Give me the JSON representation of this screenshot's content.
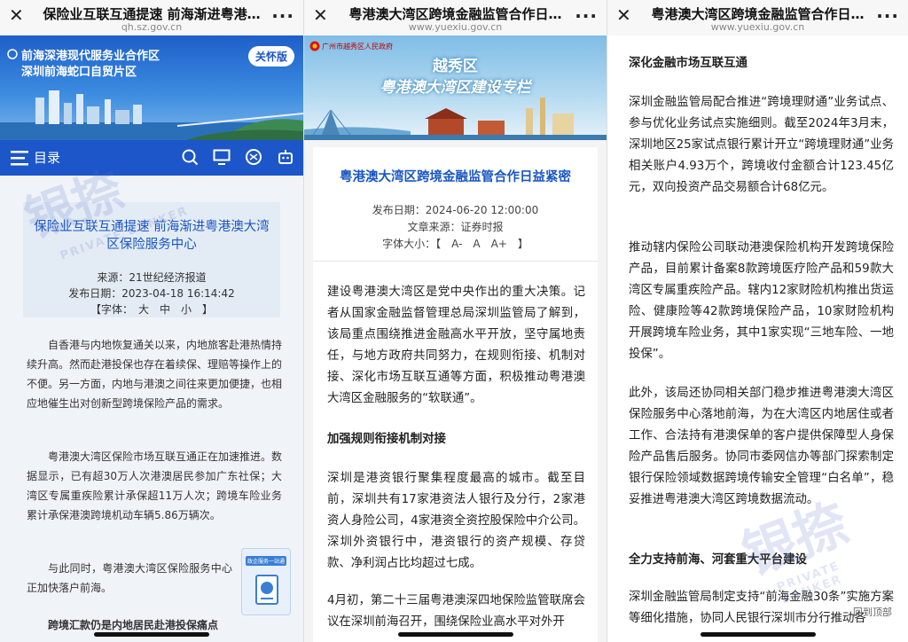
{
  "panel1": {
    "title": "保险业互联互通提速 前海渐进粤港…",
    "url": "qh.sz.gov.cn",
    "hero_line1": "前海深港现代服务业合作区",
    "hero_line2": "深圳前海蛇口自贸片区",
    "care_badge": "关怀版",
    "menu_label": "目录",
    "article_title": "保险业互联互通提速 前海渐进粤港澳大湾区保险服务中心",
    "source": "来源：21世纪经济报道",
    "date": "发布日期：2023-04-18 16:14:42",
    "font_size": "【字体：　大　中　小　】",
    "paragraphs": [
      "自香港与内地恢复通关以来，内地旅客赴港热情持续升高。然而赴港投保也存在着续保、理赔等操作上的不便。另一方面，内地与港澳之间往来更加便捷，也相应地催生出对创新型跨境保险产品的需求。",
      "粤港澳大湾区保险市场互联互通正在加速推进。数据显示，已有超30万人次港澳居民参加广东社保；大湾区专属重疾险累计承保超11万人次；跨境车险业务累计承保港澳跨境机动车辆5.86万辆次。",
      "与此同时，粤港澳大湾区保险服务中心正加快落户前海。",
      "跨境汇款仍是内地居民赴港投保痛点"
    ],
    "watermark_cn": "银捺",
    "watermark_en": "PRIVATE BANKER",
    "float_card_label": "政企服务一站通"
  },
  "panel2": {
    "title": "粤港澳大湾区跨境金融监管合作日…",
    "url": "www.yuexiu.gov.cn",
    "gov_label": "广州市越秀区人民政府",
    "hero_line1": "越秀区",
    "hero_line2": "粤港澳大湾区建设专栏",
    "article_title": "粤港澳大湾区跨境金融监管合作日益紧密",
    "date": "发布日期：2024-06-20 12:00:00",
    "source": "文章来源：证券时报",
    "font_size": "字体大小：【　A-　A　A+　】",
    "paragraphs": [
      "建设粤港澳大湾区是党中央作出的重大决策。记者从国家金融监督管理总局深圳监管局了解到，该局重点围绕推进金融高水平开放，坚守属地责任，与地方政府共同努力，在规则衔接、机制对接、深化市场互联互通等方面，积极推动粤港澳大湾区金融服务的“软联通”。",
      "加强规则衔接机制对接",
      "深圳是港资银行聚集程度最高的城市。截至目前，深圳共有17家港资法人银行及分行，2家港资人身险公司，4家港资全资控股保险中介公司。深圳外资银行中，港资银行的资产规模、存贷款、净利润占比均超过七成。",
      "4月初，第二十三届粤港澳深四地保险监管联席会议在深圳前海召开，围绕保险业高水平对外开"
    ]
  },
  "panel3": {
    "title": "粤港澳大湾区跨境金融监管合作日…",
    "url": "www.yuexiu.gov.cn",
    "paragraphs": [
      "深化金融市场互联互通",
      "深圳金融监管局配合推进“跨境理财通”业务试点、参与优化业务试点实施细则。截至2024年3月末，深圳地区25家试点银行累计开立“跨境理财通”业务相关账户4.93万个，跨境收付金额合计123.45亿元，双向投资产品交易额合计68亿元。",
      "推动辖内保险公司联动港澳保险机构开发跨境保险产品，目前累计备案8款跨境医疗险产品和59款大湾区专属重疾险产品。辖内12家财险机构推出货运险、健康险等42款跨境保险产品，10家财险机构开展跨境车险业务，其中1家实现“三地车险、一地投保”。",
      "此外，该局还协同相关部门稳步推进粤港澳大湾区保险服务中心落地前海，为在大湾区内地居住或者工作、合法持有港澳保单的客户提供保障型人身保险产品售后服务。协同市委网信办等部门探索制定银行保险领域数据跨境传输安全管理“白名单”，稳妥推进粤港澳大湾区跨境数据流动。",
      "全力支持前海、河套重大平台建设",
      "深圳金融监管局制定支持“前海金融30条”实施方案等细化措施，协同人民银行深圳市分行推动各"
    ],
    "back_to_top": "回到顶部",
    "watermark_cn": "银捺",
    "watermark_en": "PRIVATE BANKER"
  }
}
